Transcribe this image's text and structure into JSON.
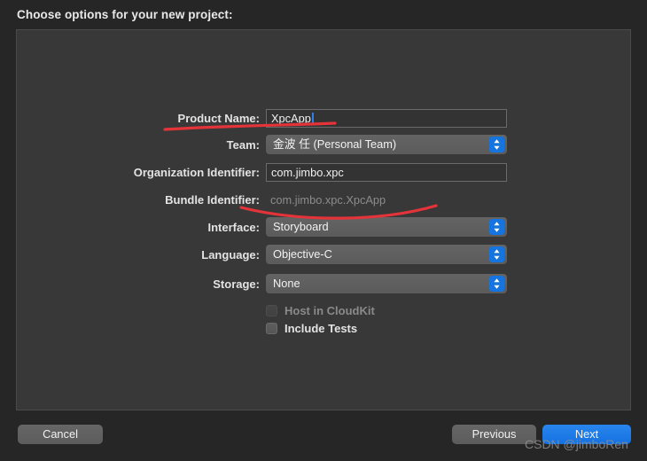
{
  "dialog": {
    "title": "Choose options for your new project:"
  },
  "form": {
    "fields": [
      {
        "name": "product-name",
        "label": "Product Name:",
        "type": "text",
        "value": "XpcApp",
        "focused": true
      },
      {
        "name": "team",
        "label": "Team:",
        "type": "popup",
        "value": "金波 任 (Personal Team)"
      },
      {
        "name": "organization-identifier",
        "label": "Organization Identifier:",
        "type": "text",
        "value": "com.jimbo.xpc",
        "focused": false
      },
      {
        "name": "bundle-identifier",
        "label": "Bundle Identifier:",
        "type": "static",
        "value": "com.jimbo.xpc.XpcApp"
      },
      {
        "name": "interface",
        "label": "Interface:",
        "type": "popup",
        "value": "Storyboard"
      },
      {
        "name": "language",
        "label": "Language:",
        "type": "popup",
        "value": "Objective-C"
      },
      {
        "name": "storage",
        "label": "Storage:",
        "type": "popup",
        "value": "None"
      }
    ],
    "checkboxes": [
      {
        "name": "host-in-cloudkit",
        "label": "Host in CloudKit",
        "checked": false,
        "enabled": false
      },
      {
        "name": "include-tests",
        "label": "Include Tests",
        "checked": false,
        "enabled": true
      }
    ]
  },
  "buttons": {
    "cancel": "Cancel",
    "previous": "Previous",
    "next": "Next"
  },
  "watermark": "CSDN @jimboRen",
  "colors": {
    "window_background": "#262626",
    "panel_background": "#383838",
    "accent_blue": "#1574dd",
    "default_button_blue": "#1371e0",
    "annotation_red": "#e5333a",
    "text_primary": "#e3e3e3",
    "text_disabled": "#8c8c8c"
  },
  "annotations": [
    {
      "name": "red-underline-product-name"
    },
    {
      "name": "red-curve-bundle-identifier"
    }
  ]
}
